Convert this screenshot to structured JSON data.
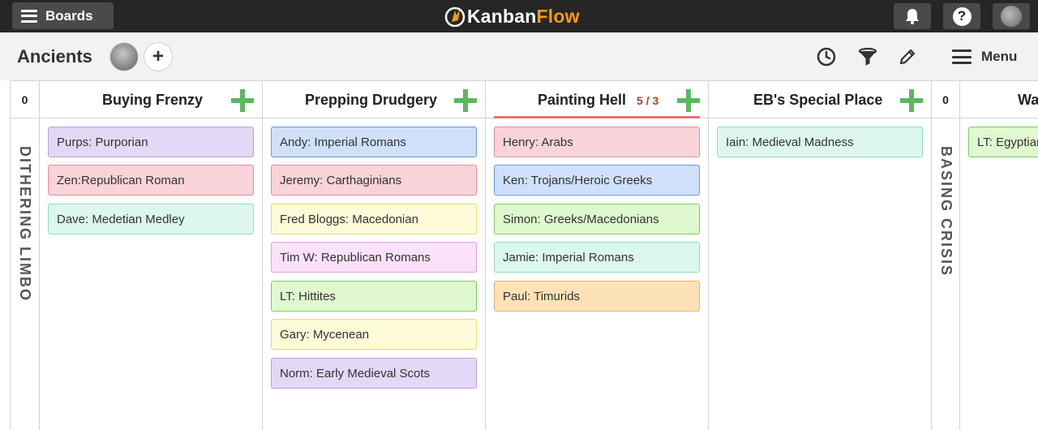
{
  "topbar": {
    "boards_label": "Boards",
    "logo_part1": "Kanban",
    "logo_part2": "Flow",
    "icons": [
      "menu-icon",
      "bell-icon",
      "help-icon",
      "avatar"
    ]
  },
  "board": {
    "title": "Ancients",
    "add_member": "+",
    "toolbar": {
      "menu_label": "Menu",
      "icons": [
        "clock-icon",
        "filter-icon",
        "pencil-icon",
        "menu-icon"
      ]
    }
  },
  "columns": {
    "dithering": {
      "count": "0",
      "name": "DITHERING LIMBO"
    },
    "buying": {
      "name": "Buying Frenzy",
      "cards": [
        "Purps: Purporian",
        "Zen:Republican Roman",
        "Dave: Medetian Medley"
      ]
    },
    "prepping": {
      "name": "Prepping Drudgery",
      "cards": [
        "Andy: Imperial Romans",
        "Jeremy: Carthaginians",
        "Fred Bloggs: Macedonian",
        "Tim W: Republican Romans",
        "LT: Hittites",
        "Gary: Mycenean",
        "Norm: Early Medieval Scots"
      ]
    },
    "painting": {
      "name": "Painting Hell",
      "wip": "5 / 3",
      "cards": [
        "Henry: Arabs",
        "Ken: Trojans/Heroic Greeks",
        "Simon: Greeks/Macedonians",
        "Jamie: Imperial Romans",
        "Paul: Timurids"
      ]
    },
    "eb": {
      "name": "EB's Special Place",
      "cards": [
        "Iain: Medieval Madness"
      ]
    },
    "basing": {
      "count": "0",
      "name": "BASING CRISIS"
    },
    "last": {
      "name": "Wa",
      "cards": [
        "LT: Egyptian"
      ]
    }
  },
  "colors": {
    "green_plus": "#5cb85c",
    "wip_red": "#c0392b",
    "logo_orange": "#f39c12"
  }
}
